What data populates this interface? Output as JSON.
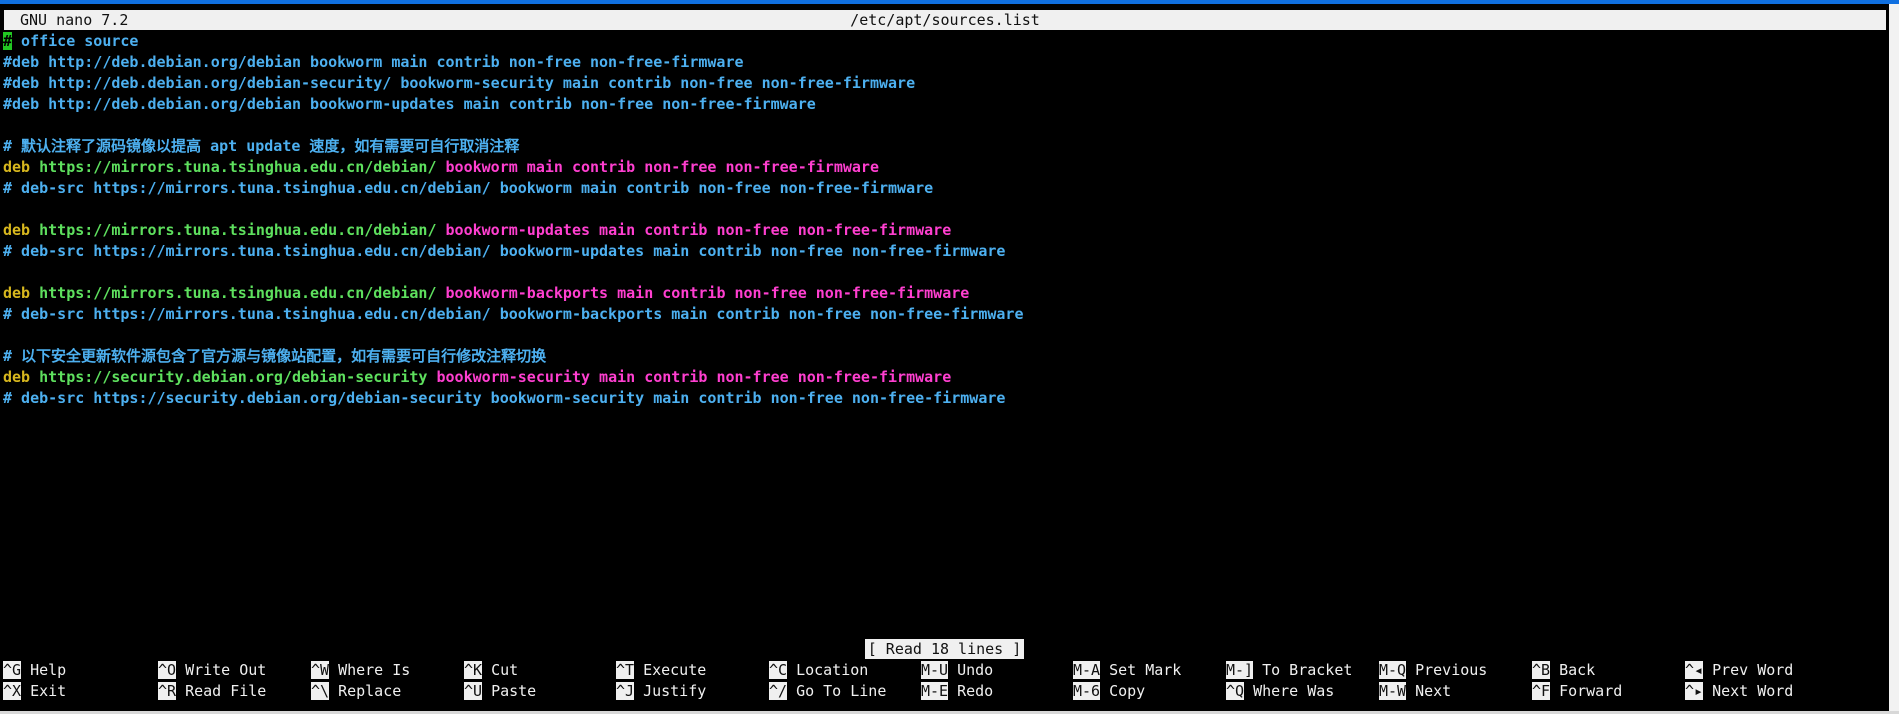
{
  "titlebar": {
    "app": "GNU nano 7.2",
    "file": "/etc/apt/sources.list"
  },
  "editor": {
    "lines": [
      [
        {
          "t": "#",
          "c": "cursor"
        },
        {
          "t": " office source",
          "c": "c-com"
        }
      ],
      [
        {
          "t": "#deb http://deb.debian.org/debian bookworm main contrib non-free non-free-firmware",
          "c": "c-com"
        }
      ],
      [
        {
          "t": "#deb http://deb.debian.org/debian-security/ bookworm-security main contrib non-free non-free-firmware",
          "c": "c-com"
        }
      ],
      [
        {
          "t": "#deb http://deb.debian.org/debian bookworm-updates main contrib non-free non-free-firmware",
          "c": "c-com"
        }
      ],
      [],
      [
        {
          "t": "# 默认注释了源码镜像以提高 apt update 速度，如有需要可自行取消注释",
          "c": "c-com"
        }
      ],
      [
        {
          "t": "deb",
          "c": "c-kw"
        },
        {
          "t": " https://mirrors.tuna.tsinghua.edu.cn/debian/",
          "c": "c-url"
        },
        {
          "t": " bookworm main contrib non-free non-free-firmware",
          "c": "c-opt"
        }
      ],
      [
        {
          "t": "# deb-src https://mirrors.tuna.tsinghua.edu.cn/debian/ bookworm main contrib non-free non-free-firmware",
          "c": "c-com"
        }
      ],
      [],
      [
        {
          "t": "deb",
          "c": "c-kw"
        },
        {
          "t": " https://mirrors.tuna.tsinghua.edu.cn/debian/",
          "c": "c-url"
        },
        {
          "t": " bookworm-updates main contrib non-free non-free-firmware",
          "c": "c-opt"
        }
      ],
      [
        {
          "t": "# deb-src https://mirrors.tuna.tsinghua.edu.cn/debian/ bookworm-updates main contrib non-free non-free-firmware",
          "c": "c-com"
        }
      ],
      [],
      [
        {
          "t": "deb",
          "c": "c-kw"
        },
        {
          "t": " https://mirrors.tuna.tsinghua.edu.cn/debian/",
          "c": "c-url"
        },
        {
          "t": " bookworm-backports main contrib non-free non-free-firmware",
          "c": "c-opt"
        }
      ],
      [
        {
          "t": "# deb-src https://mirrors.tuna.tsinghua.edu.cn/debian/ bookworm-backports main contrib non-free non-free-firmware",
          "c": "c-com"
        }
      ],
      [],
      [
        {
          "t": "# 以下安全更新软件源包含了官方源与镜像站配置，如有需要可自行修改注释切换",
          "c": "c-com"
        }
      ],
      [
        {
          "t": "deb",
          "c": "c-kw"
        },
        {
          "t": " https://security.debian.org/debian-security",
          "c": "c-url"
        },
        {
          "t": " bookworm-security main contrib non-free non-free-firmware",
          "c": "c-opt"
        }
      ],
      [
        {
          "t": "# deb-src https://security.debian.org/debian-security bookworm-security main contrib non-free non-free-firmware",
          "c": "c-com"
        }
      ]
    ]
  },
  "status": "[ Read 18 lines ]",
  "shortcuts": {
    "row1": [
      {
        "key": "^G",
        "label": "Help"
      },
      {
        "key": "^O",
        "label": "Write Out"
      },
      {
        "key": "^W",
        "label": "Where Is"
      },
      {
        "key": "^K",
        "label": "Cut"
      },
      {
        "key": "^T",
        "label": "Execute"
      },
      {
        "key": "^C",
        "label": "Location"
      },
      {
        "key": "M-U",
        "label": "Undo"
      },
      {
        "key": "M-A",
        "label": "Set Mark"
      },
      {
        "key": "M-]",
        "label": "To Bracket"
      },
      {
        "key": "M-Q",
        "label": "Previous"
      },
      {
        "key": "^B",
        "label": "Back"
      },
      {
        "key": "^◂",
        "label": "Prev Word"
      }
    ],
    "row2": [
      {
        "key": "^X",
        "label": "Exit"
      },
      {
        "key": "^R",
        "label": "Read File"
      },
      {
        "key": "^\\",
        "label": "Replace"
      },
      {
        "key": "^U",
        "label": "Paste"
      },
      {
        "key": "^J",
        "label": "Justify"
      },
      {
        "key": "^/",
        "label": "Go To Line"
      },
      {
        "key": "M-E",
        "label": "Redo"
      },
      {
        "key": "M-6",
        "label": "Copy"
      },
      {
        "key": "^Q",
        "label": "Where Was"
      },
      {
        "key": "M-W",
        "label": "Next"
      },
      {
        "key": "^F",
        "label": "Forward"
      },
      {
        "key": "^▸",
        "label": "Next Word"
      }
    ]
  },
  "colors": {
    "comment": "#4db0f0",
    "keyword": "#d8b81e",
    "url": "#5ee05e",
    "options": "#ff3fd0",
    "cursor": "#22c822"
  }
}
